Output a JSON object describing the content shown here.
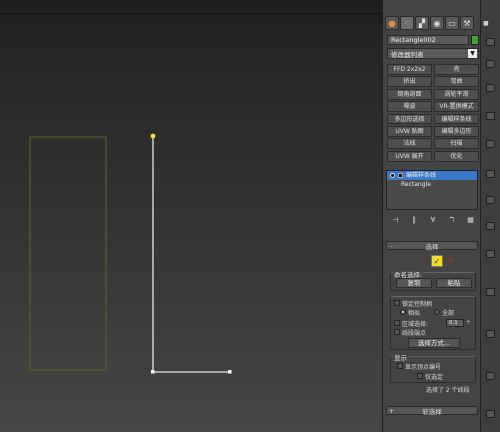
{
  "command_panel": {
    "tabs": [
      {
        "icon": "create-icon",
        "glyph": "●"
      },
      {
        "icon": "modify-icon",
        "glyph": "◜"
      },
      {
        "icon": "hierarchy-icon",
        "glyph": "▞"
      },
      {
        "icon": "motion-icon",
        "glyph": "◉"
      },
      {
        "icon": "display-icon",
        "glyph": "▭"
      },
      {
        "icon": "utilities-icon",
        "glyph": "⚒"
      }
    ],
    "object_name": "Rectangle002",
    "object_color": "#3fa82c",
    "modifier_list": "修改器列表",
    "modifier_buttons": [
      "FFD 2x2x2",
      "壳",
      "挤出",
      "弯曲",
      "倒角剖面",
      "涡轮平滑",
      "噪波",
      "VR-置换模式",
      "多边形选择",
      "编辑样条线",
      "UVW 贴图",
      "编辑多边形",
      "法线",
      "扫描",
      "UVW 展开",
      "优化"
    ],
    "stack": {
      "items": [
        {
          "label": "编辑样条线",
          "selected": true
        },
        {
          "label": "Rectangle",
          "selected": false
        }
      ]
    },
    "stack_tools": [
      "⊣",
      "‖",
      "∀",
      "ℸ",
      "▦"
    ],
    "selection_rollout": {
      "toggle": "-",
      "title": "选择",
      "named_selections": "命名选择:",
      "copy": "复制",
      "paste": "粘贴",
      "lock_handles": "锁定控制柄",
      "similar": "相似",
      "all": "全部",
      "area_selection": "区域选择:",
      "area_value": "0.1",
      "segment_end": "线段端点",
      "select_by": "选择方式...",
      "display": "显示",
      "show_vertex_numbers": "显示顶点编号",
      "selected_only": "仅选定",
      "status": "选择了 2 个线段"
    },
    "soft_selection": {
      "toggle": "+",
      "title": "软选择"
    }
  },
  "viewport": {
    "grid_color": "#556b1e",
    "line_color": "#e6e6e6",
    "vertex_color": "#f5e32a"
  }
}
